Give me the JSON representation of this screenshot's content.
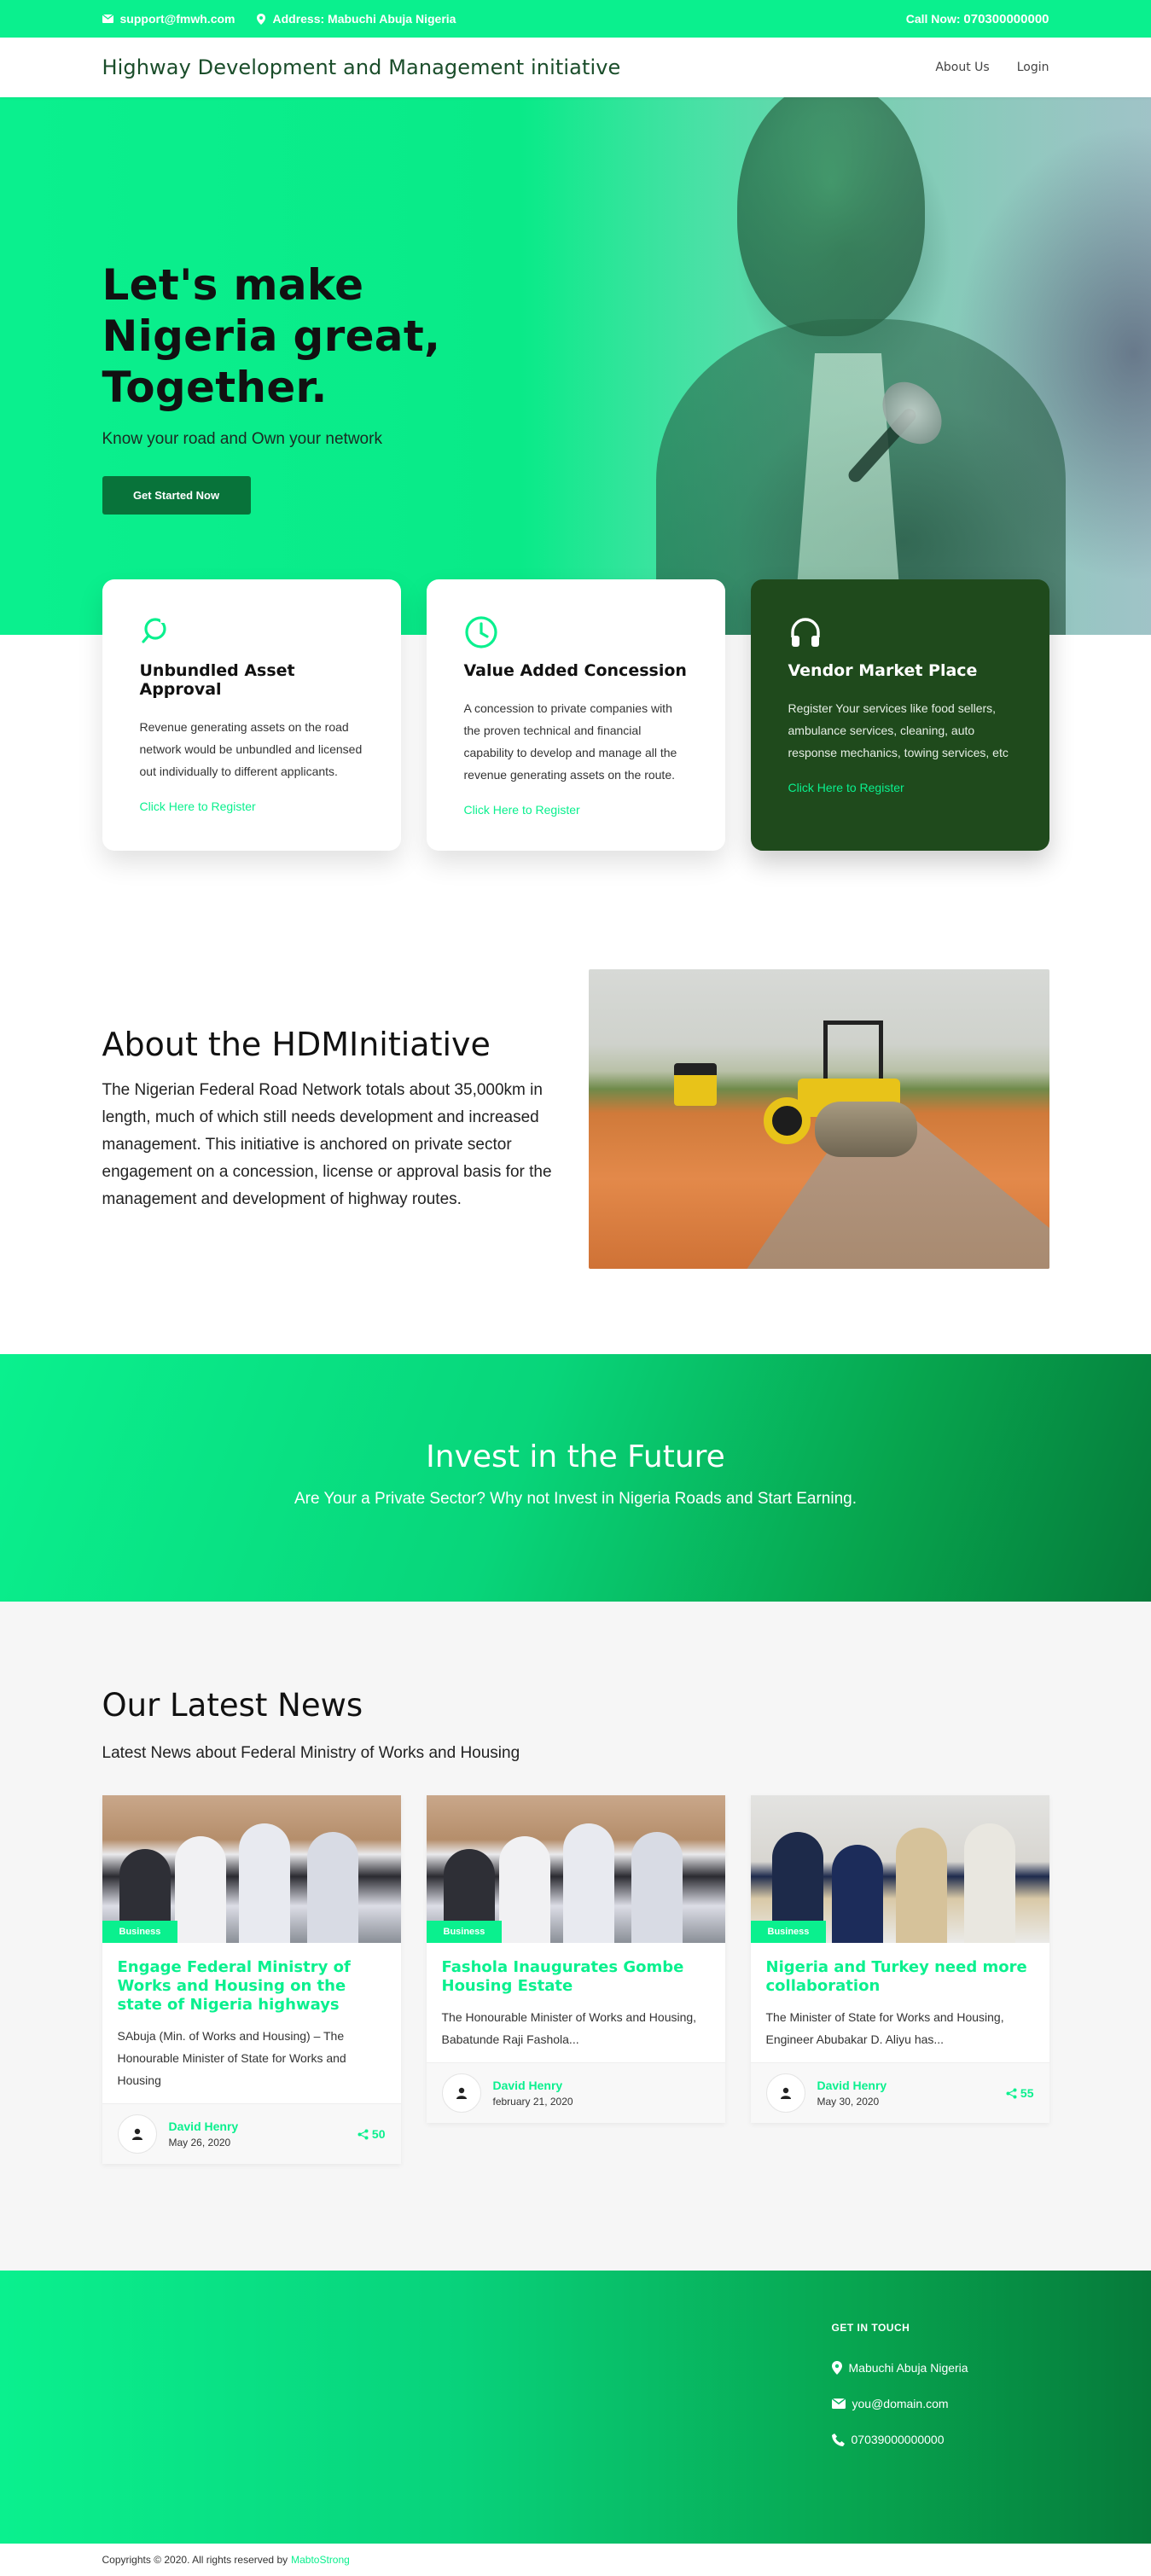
{
  "topbar": {
    "email": "support@fmwh.com",
    "address": "Address: Mabuchi Abuja Nigeria",
    "call_label": "Call Now:",
    "call_number": "070300000000"
  },
  "header": {
    "brand": "Highway Development and Management initiative",
    "nav": [
      "About Us",
      "Login"
    ]
  },
  "hero": {
    "title": "Let's make Nigeria great, Together.",
    "subtitle": "Know your road and Own your network",
    "cta": "Get Started Now"
  },
  "features": [
    {
      "icon": "refresh-icon",
      "title": "Unbundled Asset Approval",
      "text": "Revenue generating assets on the road network would be unbundled and licensed out individually to different applicants.",
      "link": "Click Here to Register"
    },
    {
      "icon": "clock-icon",
      "title": "Value Added Concession",
      "text": "A concession to private companies with the proven technical and financial capability to develop and manage all the revenue generating assets on the route.",
      "link": "Click Here to Register"
    },
    {
      "icon": "headphones-icon",
      "title": "Vendor Market Place",
      "text": "Register Your services like food sellers, ambulance services, cleaning, auto response mechanics, towing services, etc",
      "link": "Click Here to Register"
    }
  ],
  "about": {
    "title": "About the HDMInitiative",
    "text": "The Nigerian Federal Road Network totals about 35,000km in length, much of which still needs development and increased management. This initiative is anchored on private sector engagement on a concession, license or approval basis for the management and development of highway routes."
  },
  "invest": {
    "title": "Invest in the Future",
    "subtitle": "Are Your a Private Sector? Why not Invest in Nigeria Roads and Start Earning."
  },
  "news": {
    "title": "Our Latest News",
    "subtitle": "Latest News about Federal Ministry of Works and Housing",
    "items": [
      {
        "badge": "Business",
        "title": "Engage Federal Ministry of Works and Housing on the state of Nigeria highways",
        "excerpt": "SAbuja (Min. of Works and Housing) – The Honourable Minister of State for Works and Housing",
        "author": "David Henry",
        "date": "May 26, 2020",
        "shares": "50"
      },
      {
        "badge": "Business",
        "title": "Fashola Inaugurates Gombe Housing Estate",
        "excerpt": "The Honourable Minister of Works and Housing, Babatunde Raji Fashola...",
        "author": "David Henry",
        "date": "february 21, 2020",
        "shares": ""
      },
      {
        "badge": "Business",
        "title": "Nigeria and Turkey need more collaboration",
        "excerpt": "The Minister of State for Works and Housing, Engineer Abubakar D. Aliyu has...",
        "author": "David Henry",
        "date": "May 30, 2020",
        "shares": "55"
      }
    ]
  },
  "footer": {
    "heading": "GET IN TOUCH",
    "address": "Mabuchi Abuja Nigeria",
    "email": "you@domain.com",
    "phone": "07039000000000"
  },
  "copyright": {
    "text": "Copyrights © 2020. All rights reserved by",
    "link": "MabtoStrong"
  },
  "colors": {
    "accent": "#0af08e",
    "dark_green": "#08733a",
    "vendor_card": "#1f4a1c"
  }
}
